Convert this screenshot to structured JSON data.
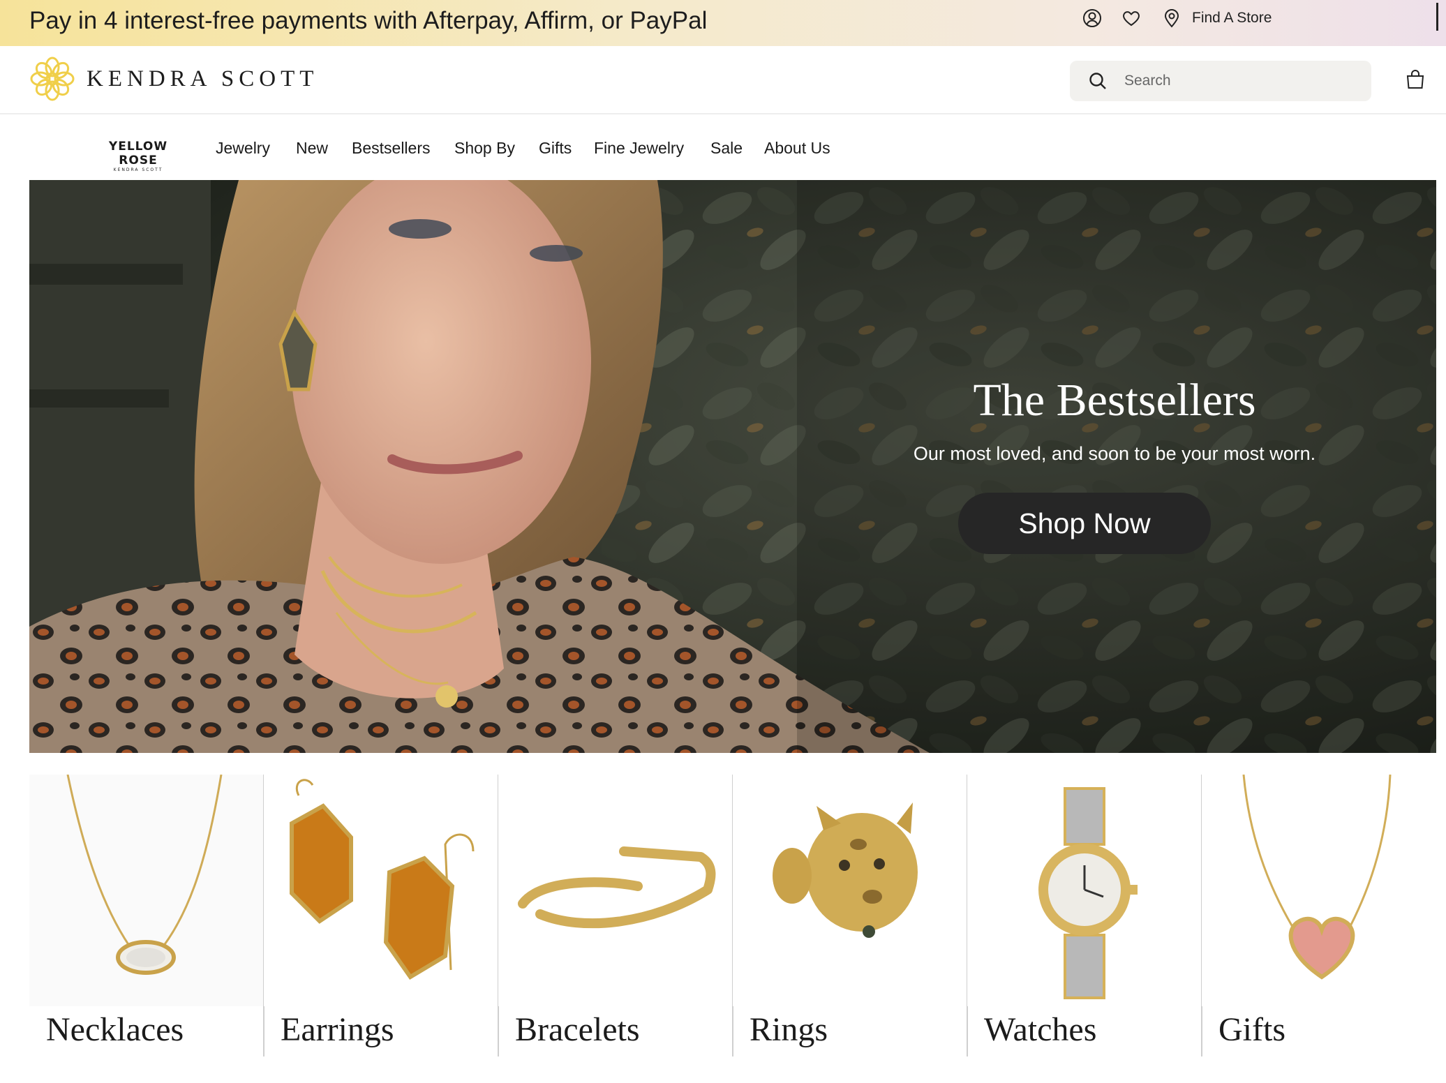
{
  "promo": {
    "text": "Pay in 4 interest-free payments with Afterpay, Affirm, or PayPal",
    "account_icon": "account-icon",
    "wishlist_icon": "heart-icon",
    "store_icon": "location-pin-icon",
    "store_link": "Find A Store"
  },
  "header": {
    "logo_text": "KENDRA SCOTT",
    "search_placeholder": "Search",
    "bag_icon": "shopping-bag-icon"
  },
  "nav": {
    "brand_main": "YELLOW ROSE",
    "brand_sub": "KENDRA SCOTT",
    "items": [
      "Jewelry",
      "New",
      "Bestsellers",
      "Shop By",
      "Gifts",
      "Fine Jewelry",
      "Sale",
      "About Us"
    ]
  },
  "hero": {
    "title": "The Bestsellers",
    "subtitle": "Our most loved, and soon to be your most worn.",
    "cta": "Shop Now"
  },
  "categories": [
    {
      "label": "Necklaces"
    },
    {
      "label": "Earrings"
    },
    {
      "label": "Bracelets"
    },
    {
      "label": "Rings"
    },
    {
      "label": "Watches"
    },
    {
      "label": "Gifts"
    }
  ],
  "colors": {
    "promo_gradient_start": "#f6e39a",
    "promo_gradient_end": "#eee0ea",
    "logo_gold": "#f0cf4a",
    "cta_background": "#262626",
    "search_background": "#f2f1ee"
  }
}
